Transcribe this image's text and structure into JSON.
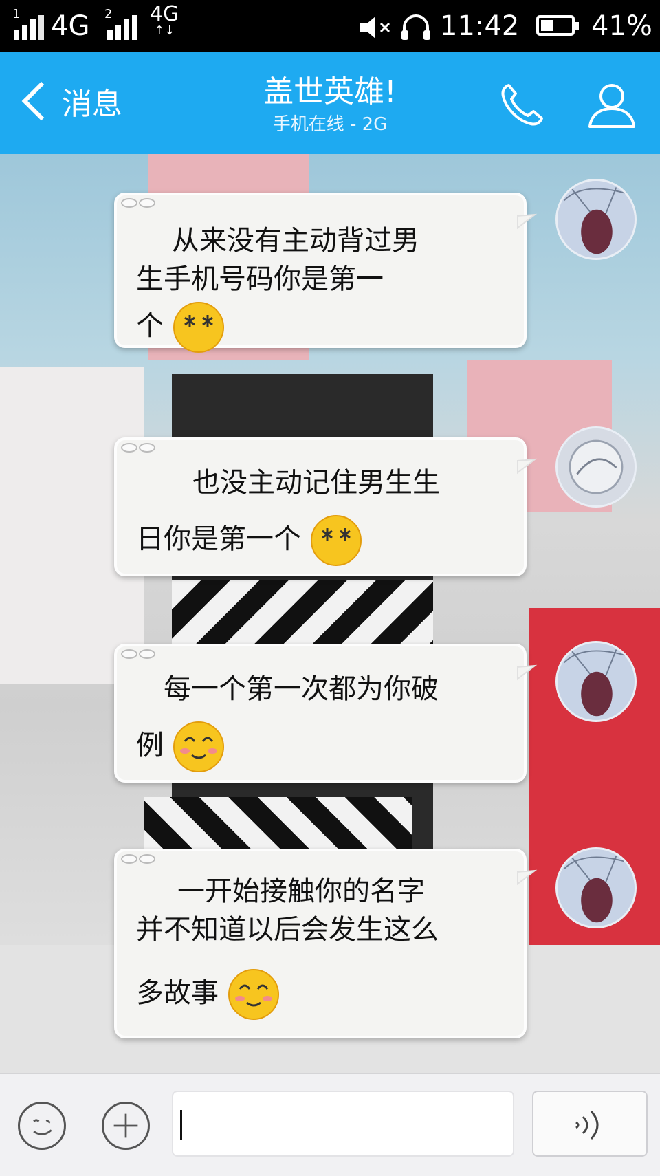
{
  "status_bar": {
    "sim1_index": "1",
    "sim1_network": "4G",
    "sim2_index": "2",
    "sim2_network": "4G",
    "sim2_arrows": "↑↓",
    "time": "11:42",
    "battery_percent_label": "41%",
    "battery_level": 0.41,
    "icons": [
      "signal-icon",
      "mute-icon",
      "headset-icon",
      "battery-icon"
    ]
  },
  "header": {
    "back_label": "消息",
    "title": "盖世英雄!",
    "subtitle": "手机在线 - 2G",
    "icons": [
      "back-chevron-icon",
      "phone-icon",
      "profile-icon"
    ],
    "background_color": "#1eaaf1"
  },
  "messages": [
    {
      "sender": "self",
      "lines": [
        "从来没有主动背过男",
        "生手机号码你是第一",
        "个"
      ],
      "emoji": "dizzy-face-emoji"
    },
    {
      "sender": "self",
      "lines": [
        "也没主动记住男生生",
        "日你是第一个"
      ],
      "emoji": "dizzy-face-emoji"
    },
    {
      "sender": "self",
      "lines": [
        "每一个第一次都为你破",
        "例"
      ],
      "emoji": "smiling-face-emoji"
    },
    {
      "sender": "self",
      "lines": [
        "一开始接触你的名字",
        "并不知道以后会发生这么",
        "多故事"
      ],
      "emoji": "smiling-face-emoji"
    }
  ],
  "input_bar": {
    "input_value": "",
    "icons": [
      "emoji-face-icon",
      "plus-icon",
      "voice-wave-icon"
    ]
  }
}
